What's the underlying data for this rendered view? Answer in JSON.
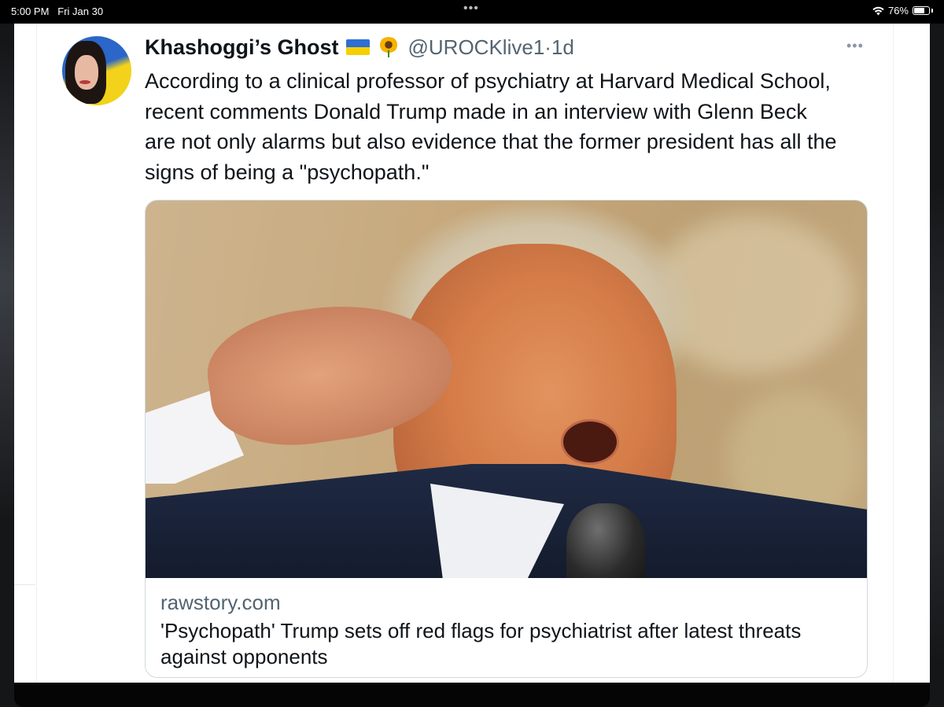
{
  "status_bar": {
    "time": "5:00 PM",
    "date": "Fri Jan 30",
    "dots": "•••",
    "battery_percent": "76%",
    "battery_level": 0.76
  },
  "tweet": {
    "display_name": "Khashoggi’s Ghost",
    "handle": "@UROCKlive1",
    "separator": "·",
    "age": "1d",
    "more": "•••",
    "text": "According to a clinical professor of psychiatry at Harvard Medical School, recent comments Donald Trump made in an interview with Glenn Beck are not only alarms but also evidence that the former president has all the signs of being a \"psychopath.\"",
    "link_card": {
      "domain": "rawstory.com",
      "title": "'Psychopath' Trump sets off red flags for psychiatrist after latest threats against opponents"
    }
  },
  "colors": {
    "text_primary": "#0f1419",
    "text_secondary": "#536471",
    "border": "#cfd9de"
  }
}
